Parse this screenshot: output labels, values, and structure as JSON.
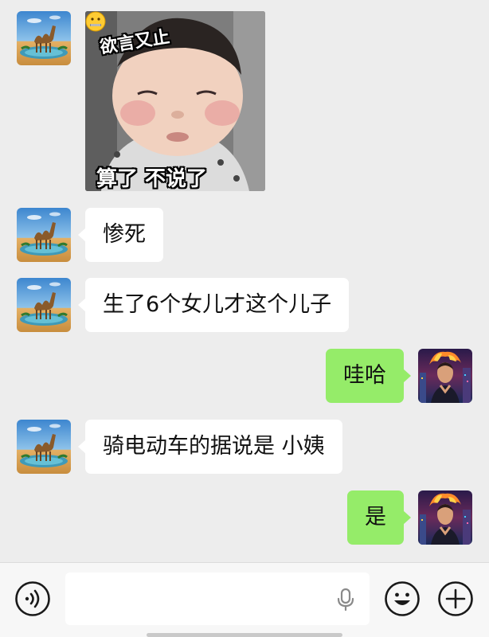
{
  "conversation": {
    "sticker": {
      "caption_top": "欲言又止",
      "caption_bottom": "算了  不说了",
      "emoji": "zipper-mouth-face"
    },
    "messages": [
      {
        "direction": "incoming",
        "text": "惨死"
      },
      {
        "direction": "incoming",
        "text": "生了6个女儿才这个儿子"
      },
      {
        "direction": "outgoing",
        "text": "哇哈"
      },
      {
        "direction": "incoming",
        "text": "骑电动车的据说是 小姨"
      },
      {
        "direction": "outgoing",
        "text": "是"
      }
    ]
  },
  "input_bar": {
    "voice_icon": "voice-toggle-icon",
    "mic_icon": "microphone-icon",
    "emoji_icon": "emoji-icon",
    "more_icon": "plus-circle-icon",
    "text_value": ""
  },
  "colors": {
    "background": "#ededed",
    "incoming_bubble": "#ffffff",
    "outgoing_bubble": "#95ec69"
  }
}
